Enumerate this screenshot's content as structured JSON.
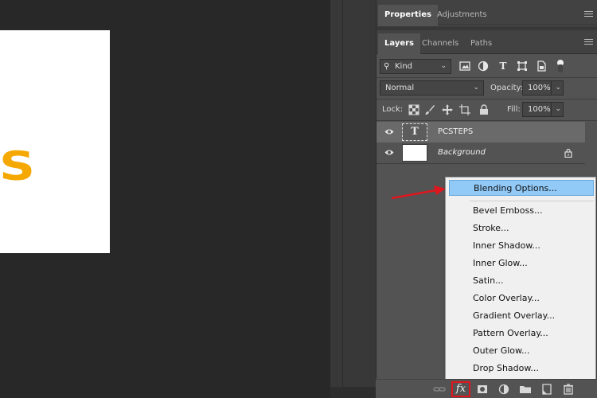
{
  "canvas": {
    "visible_text": "PS",
    "text_color": "#f5a800"
  },
  "top_tabs": [
    "Properties",
    "Adjustments"
  ],
  "layers_tabs": [
    "Layers",
    "Channels",
    "Paths"
  ],
  "filter": {
    "kind": "Kind"
  },
  "blend": {
    "mode": "Normal",
    "opacity_label": "Opacity:",
    "opacity_value": "100%"
  },
  "lock": {
    "label": "Lock:",
    "fill_label": "Fill:",
    "fill_value": "100%"
  },
  "layers": [
    {
      "name": "PCSTEPS",
      "type": "text",
      "thumb_glyph": "T",
      "selected": true
    },
    {
      "name": "Background",
      "type": "image",
      "locked": true,
      "selected": false
    }
  ],
  "context_menu": {
    "items": [
      "Blending Options...",
      "Bevel  Emboss...",
      "Stroke...",
      "Inner Shadow...",
      "Inner Glow...",
      "Satin...",
      "Color Overlay...",
      "Gradient Overlay...",
      "Pattern Overlay...",
      "Outer Glow...",
      "Drop Shadow..."
    ],
    "highlighted": "Blending Options...",
    "highlight_color": "#91c9f7"
  },
  "bottom_bar": {
    "fx_label": "fx"
  },
  "annotation": {
    "arrow_color": "#e0161e",
    "fx_highlight_color": "#e0161e"
  }
}
